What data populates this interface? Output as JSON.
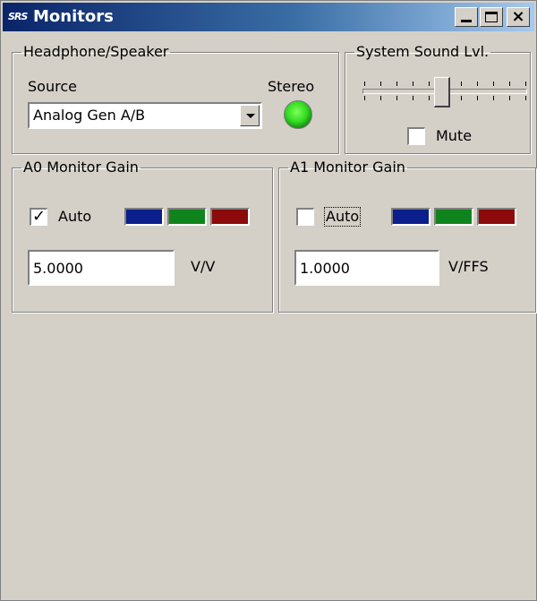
{
  "window": {
    "title": "Monitors",
    "logo_text": "SRS",
    "controls": {
      "minimize": "minimize",
      "maximize": "maximize",
      "close": "×"
    }
  },
  "headphone_speaker": {
    "legend": "Headphone/Speaker",
    "source_label": "Source",
    "source_value": "Analog Gen A/B",
    "stereo_label": "Stereo",
    "stereo_led_color": "#33dd22"
  },
  "system_sound": {
    "legend": "System Sound Lvl.",
    "mute_label": "Mute",
    "mute_checked": false
  },
  "a0": {
    "legend": "A0 Monitor Gain",
    "auto_label": "Auto",
    "auto_checked": true,
    "auto_mark": "✓",
    "gain_value": "5.0000",
    "unit": "V/V",
    "swatches": [
      "#0a1e8c",
      "#10841c",
      "#8c0a0a"
    ]
  },
  "a1": {
    "legend": "A1 Monitor Gain",
    "auto_label": "Auto",
    "auto_checked": false,
    "auto_mark": "",
    "gain_value": "1.0000",
    "unit": "V/FFS",
    "swatches": [
      "#0a1e8c",
      "#10841c",
      "#8c0a0a"
    ]
  }
}
